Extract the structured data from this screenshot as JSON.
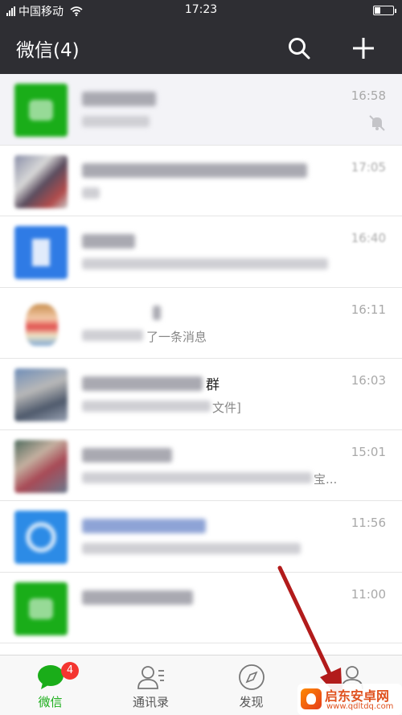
{
  "status_bar": {
    "carrier": "中国移动",
    "time": "17:23",
    "signal_icon": "signal-icon",
    "wifi_icon": "wifi-icon",
    "battery_level": 0.35
  },
  "header": {
    "title": "微信(4)",
    "search_icon": "search-icon",
    "add_icon": "plus-icon"
  },
  "chats": [
    {
      "time": "16:58",
      "muted": true,
      "name": "",
      "message": ""
    },
    {
      "time": "17:05",
      "muted": false,
      "name": "",
      "message": ""
    },
    {
      "time": "16:40",
      "muted": false,
      "name": "",
      "message": ""
    },
    {
      "time": "16:11",
      "muted": false,
      "name": "",
      "message": "了一条消息"
    },
    {
      "time": "16:03",
      "muted": false,
      "name": "群",
      "message": "文件]"
    },
    {
      "time": "15:01",
      "muted": false,
      "name": "",
      "message": "宝..."
    },
    {
      "time": "11:56",
      "muted": false,
      "name": "",
      "message": ""
    },
    {
      "time": "11:00",
      "muted": false,
      "name": "",
      "message": ""
    }
  ],
  "tabbar": {
    "tabs": [
      {
        "label": "微信",
        "icon": "chat-bubble-icon",
        "active": true,
        "badge": "4"
      },
      {
        "label": "通讯录",
        "icon": "contacts-icon",
        "active": false
      },
      {
        "label": "发现",
        "icon": "compass-icon",
        "active": false
      },
      {
        "label": "我",
        "icon": "person-icon",
        "active": false
      }
    ]
  },
  "overlay": {
    "arrow_color": "#b21b1b",
    "watermark_title": "启东安卓网",
    "watermark_url": "www.qdltdq.com"
  },
  "colors": {
    "accent": "#1aad19",
    "header_bg": "#2e2e33",
    "badge": "#f43530"
  }
}
